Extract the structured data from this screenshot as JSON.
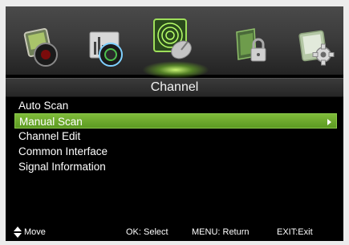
{
  "tabs": [
    {
      "name": "picture-tab",
      "icon": "picture-icon",
      "selected": false
    },
    {
      "name": "sound-tab",
      "icon": "sound-icon",
      "selected": false
    },
    {
      "name": "channel-tab",
      "icon": "satellite-dish-icon",
      "selected": true
    },
    {
      "name": "lock-tab",
      "icon": "lock-icon",
      "selected": false
    },
    {
      "name": "setup-tab",
      "icon": "gear-icon",
      "selected": false
    }
  ],
  "title": "Channel",
  "menu": {
    "items": [
      {
        "label": "Auto Scan"
      },
      {
        "label": "Manual Scan",
        "selected": true
      },
      {
        "label": "Channel Edit"
      },
      {
        "label": "Common Interface"
      },
      {
        "label": "Signal Information"
      }
    ]
  },
  "footer": {
    "move": "Move",
    "ok": "OK: Select",
    "menu": "MENU: Return",
    "exit": "EXIT:Exit"
  },
  "colors": {
    "selection": "#6fae2e",
    "background": "#000000",
    "text": "#ffffff"
  }
}
